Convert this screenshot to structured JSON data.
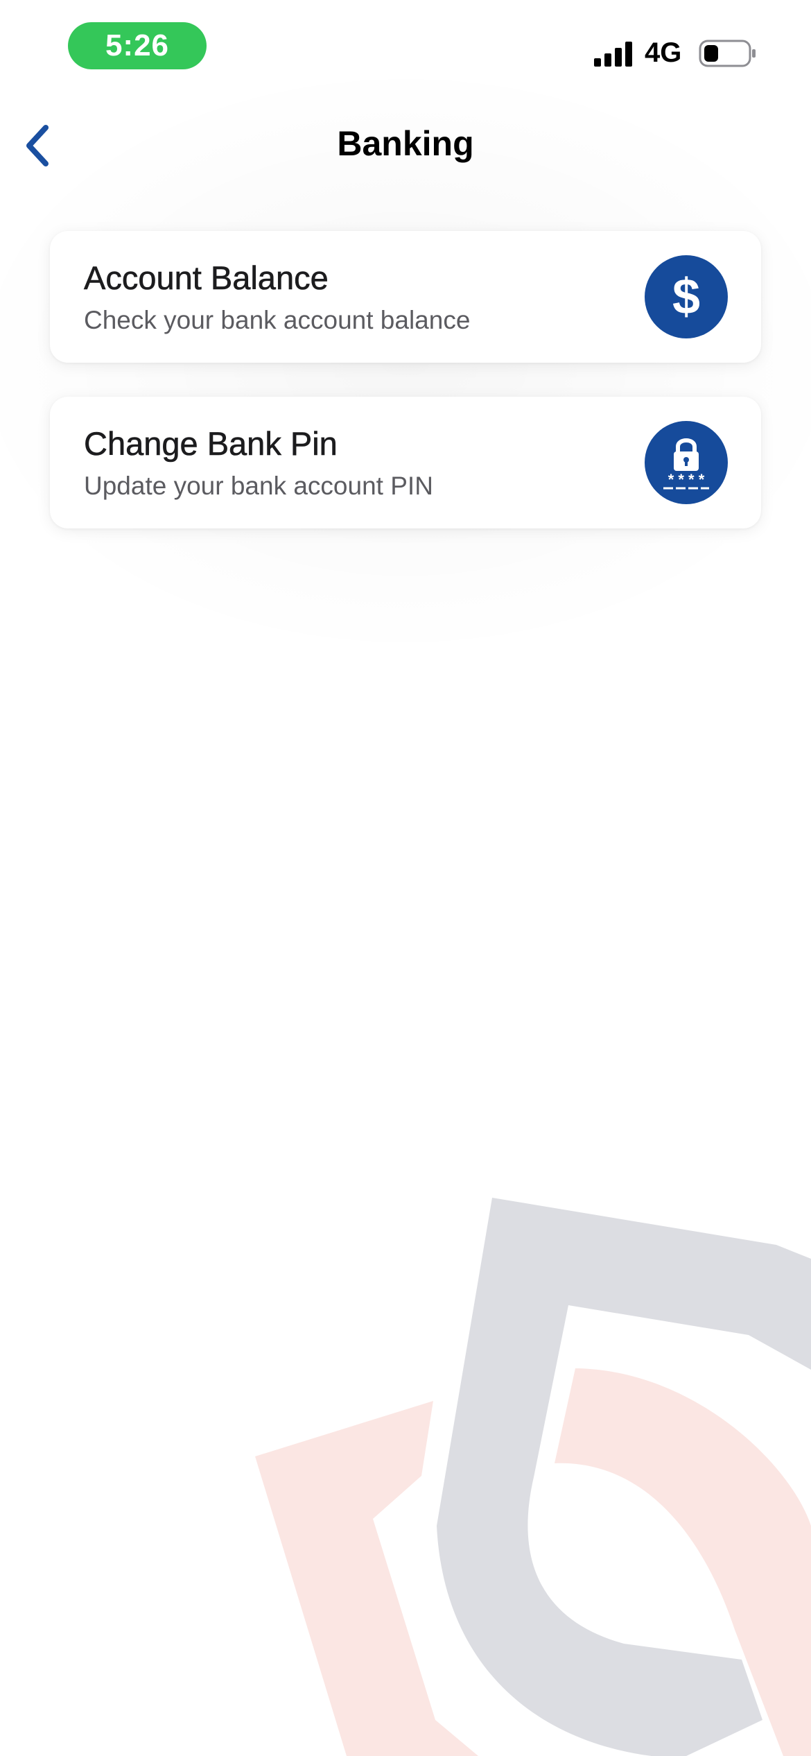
{
  "status_bar": {
    "time": "5:26",
    "network": "4G",
    "time_pill_color": "#34c759",
    "icons": [
      "signal-icon",
      "battery-icon"
    ]
  },
  "nav": {
    "title": "Banking",
    "back_icon": "chevron-left-icon",
    "accent_color": "#1a4fa0"
  },
  "items": [
    {
      "title": "Account Balance",
      "subtitle": "Check your bank account balance",
      "icon": "dollar-icon"
    },
    {
      "title": "Change Bank Pin",
      "subtitle": "Update your bank account PIN",
      "icon": "lock-pin-icon"
    }
  ],
  "colors": {
    "icon_circle": "#164b9b",
    "watermark_gray": "#dcdde2",
    "watermark_red": "#fbe6e3"
  }
}
